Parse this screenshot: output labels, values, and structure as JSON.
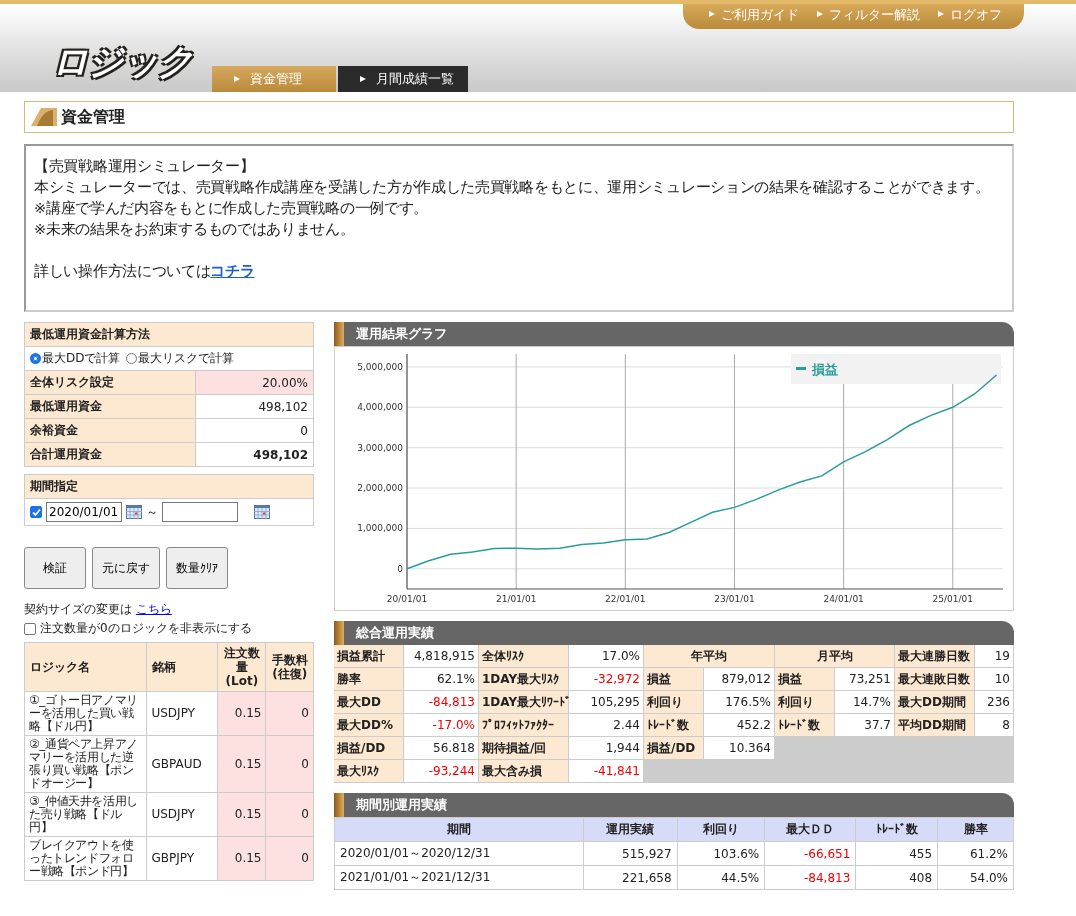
{
  "header": {
    "logo": "ロジック",
    "top_links": [
      "ご利用ガイド",
      "フィルター解説",
      "ログオフ"
    ],
    "nav_tabs": [
      {
        "label": "資金管理",
        "selected": true
      },
      {
        "label": "月間成績一覧",
        "selected": false
      }
    ]
  },
  "page_title": "資金管理",
  "intro": {
    "lines": [
      "【売買戦略運用シミュレーター】",
      "本シミュレーターでは、売買戦略作成講座を受講した方が作成した売買戦略をもとに、運用シミュレーションの結果を確認することができます。",
      "※講座で学んだ内容をもとに作成した売買戦略の一例です。",
      "※未来の結果をお約束するものではありません。"
    ],
    "link_prefix": "詳しい操作方法については",
    "link": "コチラ"
  },
  "calc_method": {
    "title": "最低運用資金計算方法",
    "options": [
      {
        "label": "最大DDで計算",
        "selected": true
      },
      {
        "label": "最大リスクで計算",
        "selected": false
      }
    ],
    "rows": [
      {
        "label": "全体リスク設定",
        "value": "20.00%",
        "highlight": true,
        "bold": false
      },
      {
        "label": "最低運用資金",
        "value": "498,102",
        "highlight": false,
        "bold": false
      },
      {
        "label": "余裕資金",
        "value": "0",
        "highlight": false,
        "bold": false
      },
      {
        "label": "合計運用資金",
        "value": "498,102",
        "highlight": false,
        "bold": true
      }
    ]
  },
  "period": {
    "title": "期間指定",
    "checked": true,
    "start": "2020/01/01",
    "separator": "～"
  },
  "buttons": [
    "検証",
    "元に戻す",
    "数量ｸﾘｱ"
  ],
  "contract_note": {
    "text": "契約サイズの変更は",
    "link": "こちら"
  },
  "hide_zero": {
    "label": "注文数量が0のロジックを非表示にする",
    "checked": false
  },
  "logic_table": {
    "columns": [
      "ロジック名",
      "銘柄",
      "注文数量(Lot)",
      "手数料(往復)"
    ],
    "rows": [
      {
        "name": "①_ゴトー日アノマリーを活用した買い戦略【ドル円】",
        "symbol": "USDJPY",
        "lots": "0.15",
        "fee": "0"
      },
      {
        "name": "②_通貨ペア上昇アノマリーを活用した逆張り買い戦略【ポンドオージー】",
        "symbol": "GBPAUD",
        "lots": "0.15",
        "fee": "0"
      },
      {
        "name": "③_仲値天井を活用した売り戦略【ドル円】",
        "symbol": "USDJPY",
        "lots": "0.15",
        "fee": "0"
      },
      {
        "name": "ブレイクアウトを使ったトレンドフォロー戦略【ポンド円】",
        "symbol": "GBPJPY",
        "lots": "0.15",
        "fee": "0"
      }
    ]
  },
  "graph_panel": {
    "title": "運用結果グラフ",
    "chart_data": {
      "type": "line",
      "categories": [
        "20/01/01",
        null,
        null,
        null,
        null,
        "21/01/01",
        null,
        null,
        null,
        null,
        "22/01/01",
        null,
        null,
        null,
        null,
        "23/01/01",
        null,
        null,
        null,
        null,
        "24/01/01",
        null,
        null,
        null,
        null,
        "25/01/01",
        null,
        null
      ],
      "series": [
        {
          "name": "損益",
          "color": "#2a9d99",
          "values": [
            0,
            200000,
            360000,
            420000,
            500000,
            510000,
            490000,
            510000,
            600000,
            640000,
            720000,
            740000,
            900000,
            1150000,
            1400000,
            1520000,
            1720000,
            1950000,
            2150000,
            2300000,
            2650000,
            2900000,
            3200000,
            3550000,
            3800000,
            4000000,
            4330000,
            4800000
          ]
        }
      ],
      "ylim": [
        -500000,
        5320000
      ],
      "grid": true,
      "yticks": [
        {
          "value": 0,
          "label": "0"
        },
        {
          "value": 1000000,
          "label": "1,000,000"
        },
        {
          "value": 2000000,
          "label": "2,000,000"
        },
        {
          "value": 3000000,
          "label": "3,000,000"
        },
        {
          "value": 4000000,
          "label": "4,000,000"
        },
        {
          "value": 5000000,
          "label": "5,000,000"
        }
      ]
    }
  },
  "summary_panel": {
    "title": "総合運用実績",
    "rows": [
      [
        {
          "text": "損益累計",
          "kind": "label"
        },
        {
          "text": "4,818,915",
          "kind": "value",
          "negative": false
        },
        {
          "text": "全体ﾘｽｸ",
          "kind": "label"
        },
        {
          "text": "17.0%",
          "kind": "value",
          "negative": false
        },
        {
          "text": "年平均",
          "kind": "header"
        },
        {
          "text": "",
          "kind": "merged"
        },
        {
          "text": "月平均",
          "kind": "header"
        },
        {
          "text": "",
          "kind": "merged"
        },
        {
          "text": "最大連勝日数",
          "kind": "label"
        },
        {
          "text": "19",
          "kind": "value",
          "negative": false
        }
      ],
      [
        {
          "text": "勝率",
          "kind": "label"
        },
        {
          "text": "62.1%",
          "kind": "value",
          "negative": false
        },
        {
          "text": "1DAY最大ﾘｽｸ",
          "kind": "label"
        },
        {
          "text": "-32,972",
          "kind": "value",
          "negative": true
        },
        {
          "text": "損益",
          "kind": "label"
        },
        {
          "text": "879,012",
          "kind": "value",
          "negative": false
        },
        {
          "text": "損益",
          "kind": "label"
        },
        {
          "text": "73,251",
          "kind": "value",
          "negative": false
        },
        {
          "text": "最大連敗日数",
          "kind": "label"
        },
        {
          "text": "10",
          "kind": "value",
          "negative": false
        }
      ],
      [
        {
          "text": "最大DD",
          "kind": "label"
        },
        {
          "text": "-84,813",
          "kind": "value",
          "negative": true
        },
        {
          "text": "1DAY最大ﾘﾜｰﾄﾞ",
          "kind": "label"
        },
        {
          "text": "105,295",
          "kind": "value",
          "negative": false
        },
        {
          "text": "利回り",
          "kind": "label"
        },
        {
          "text": "176.5%",
          "kind": "value",
          "negative": false
        },
        {
          "text": "利回り",
          "kind": "label"
        },
        {
          "text": "14.7%",
          "kind": "value",
          "negative": false
        },
        {
          "text": "最大DD期間",
          "kind": "label"
        },
        {
          "text": "236",
          "kind": "value",
          "negative": false
        }
      ],
      [
        {
          "text": "最大DD%",
          "kind": "label"
        },
        {
          "text": "-17.0%",
          "kind": "value",
          "negative": true
        },
        {
          "text": "ﾌﾟﾛﾌｨｯﾄﾌｧｸﾀｰ",
          "kind": "label"
        },
        {
          "text": "2.44",
          "kind": "value",
          "negative": false
        },
        {
          "text": "ﾄﾚｰﾄﾞ数",
          "kind": "label"
        },
        {
          "text": "452.2",
          "kind": "value",
          "negative": false
        },
        {
          "text": "ﾄﾚｰﾄﾞ数",
          "kind": "label"
        },
        {
          "text": "37.7",
          "kind": "value",
          "negative": false
        },
        {
          "text": "平均DD期間",
          "kind": "label"
        },
        {
          "text": "8",
          "kind": "value",
          "negative": false
        }
      ],
      [
        {
          "text": "損益/DD",
          "kind": "label"
        },
        {
          "text": "56.818",
          "kind": "value",
          "negative": false
        },
        {
          "text": "期待損益/回",
          "kind": "label"
        },
        {
          "text": "1,944",
          "kind": "value",
          "negative": false
        },
        {
          "text": "損益/DD",
          "kind": "label"
        },
        {
          "text": "10.364",
          "kind": "value",
          "negative": false
        },
        {
          "kind": "blank"
        },
        {
          "kind": "blank"
        },
        {
          "kind": "blank"
        },
        {
          "kind": "blank"
        }
      ],
      [
        {
          "text": "最大ﾘｽｸ",
          "kind": "label"
        },
        {
          "text": "-93,244",
          "kind": "value",
          "negative": true
        },
        {
          "text": "最大含み損",
          "kind": "label"
        },
        {
          "text": "-41,841",
          "kind": "value",
          "negative": true
        },
        {
          "kind": "blank"
        },
        {
          "kind": "blank"
        },
        {
          "kind": "blank"
        },
        {
          "kind": "blank"
        },
        {
          "kind": "blank"
        },
        {
          "kind": "blank"
        }
      ]
    ]
  },
  "period_panel": {
    "title": "期間別運用実績",
    "columns": [
      "期間",
      "運用実績",
      "利回り",
      "最大ＤＤ",
      "ﾄﾚｰﾄﾞ数",
      "勝率"
    ],
    "rows": [
      {
        "period": "2020/01/01～2020/12/31",
        "result": "515,927",
        "yield": "103.6%",
        "max_dd": "-66,651",
        "trades": "455",
        "win_rate": "61.2%"
      },
      {
        "period": "2021/01/01～2021/12/31",
        "result": "221,658",
        "yield": "44.5%",
        "max_dd": "-84,813",
        "trades": "408",
        "win_rate": "54.0%"
      }
    ]
  }
}
